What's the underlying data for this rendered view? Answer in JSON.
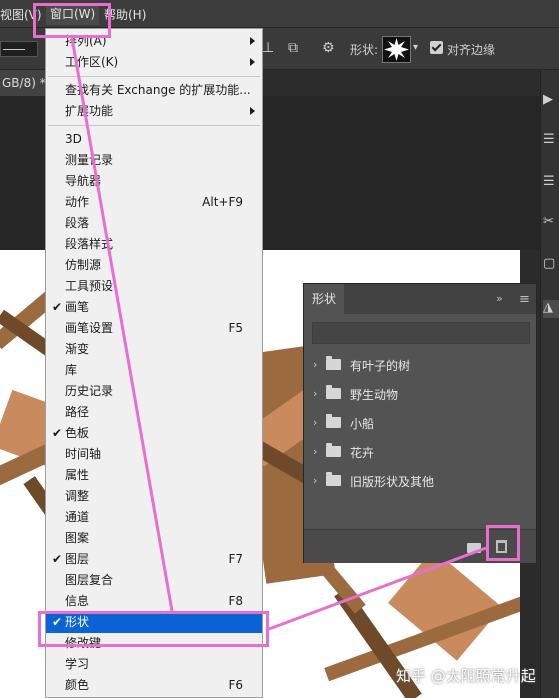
{
  "menubar": {
    "view_label": "视图(V)",
    "window_label": "窗口(W)",
    "help_label": "帮助(H)"
  },
  "options_bar": {
    "shape_label": "形状:",
    "align_edges_label": "对齐边缘",
    "align_edges_checked": true
  },
  "document": {
    "tab_title": "GB/8) *"
  },
  "window_menu": {
    "items": [
      {
        "label": "排列(A)",
        "submenu": true
      },
      {
        "label": "工作区(K)",
        "submenu": true
      },
      {
        "label": "查找有关 Exchange 的扩展功能..."
      },
      {
        "label": "扩展功能",
        "submenu": true
      },
      {
        "label": "3D"
      },
      {
        "label": "测量记录"
      },
      {
        "label": "导航器"
      },
      {
        "label": "动作",
        "shortcut": "Alt+F9"
      },
      {
        "label": "段落"
      },
      {
        "label": "段落样式"
      },
      {
        "label": "仿制源"
      },
      {
        "label": "工具预设"
      },
      {
        "label": "画笔",
        "checked": true
      },
      {
        "label": "画笔设置",
        "shortcut": "F5"
      },
      {
        "label": "渐变"
      },
      {
        "label": "库"
      },
      {
        "label": "历史记录"
      },
      {
        "label": "路径"
      },
      {
        "label": "色板",
        "checked": true
      },
      {
        "label": "时间轴"
      },
      {
        "label": "属性"
      },
      {
        "label": "调整"
      },
      {
        "label": "通道"
      },
      {
        "label": "图案"
      },
      {
        "label": "图层",
        "checked": true,
        "shortcut": "F7"
      },
      {
        "label": "图层复合"
      },
      {
        "label": "信息",
        "shortcut": "F8"
      },
      {
        "label": "形状",
        "checked": true,
        "selected": true
      },
      {
        "label": "修改键"
      },
      {
        "label": "学习"
      },
      {
        "label": "颜色",
        "shortcut": "F6"
      }
    ],
    "check_mark": "✔"
  },
  "shapes_panel": {
    "tab_label": "形状",
    "collapse_glyph": "»",
    "menu_glyph": "≡",
    "groups": [
      {
        "name": "有叶子的树"
      },
      {
        "name": "野生动物"
      },
      {
        "name": "小船"
      },
      {
        "name": "花卉"
      },
      {
        "name": "旧版形状及其他"
      }
    ]
  },
  "watermark": "知乎 @太阳照常升起",
  "colors": {
    "annotation": "#e86fd2",
    "menu_selected": "#0a64d6"
  },
  "icons": [
    "gear-icon",
    "star-burst-shape-icon",
    "folder-icon",
    "trash-icon",
    "chevron-right-icon"
  ]
}
